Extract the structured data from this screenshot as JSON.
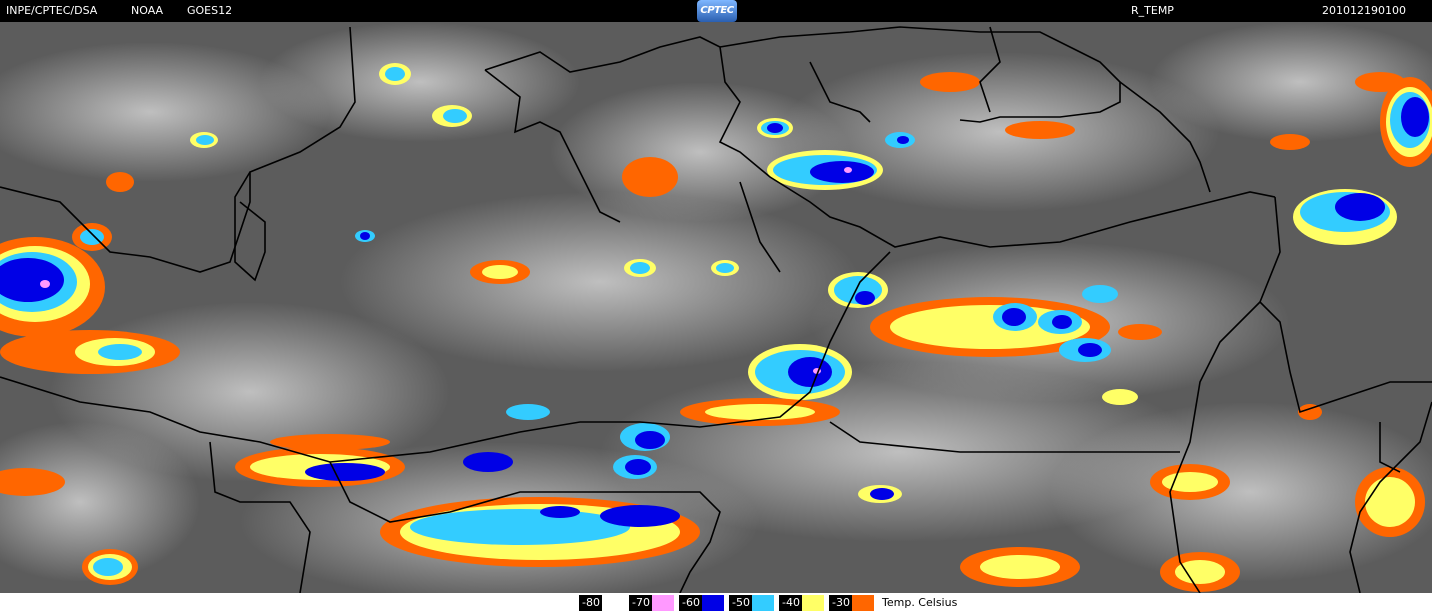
{
  "header": {
    "source": "INPE/CPTEC/DSA",
    "agency": "NOAA",
    "satellite": "GOES12",
    "logo_text": "CPTEC",
    "product": "R_TEMP",
    "timestamp": "201012190100"
  },
  "legend": {
    "entries": [
      {
        "label": "-80",
        "color": "#ffffff"
      },
      {
        "label": "-70",
        "color": "#ff99ff"
      },
      {
        "label": "-60",
        "color": "#0000e6"
      },
      {
        "label": "-50",
        "color": "#33ccff"
      },
      {
        "label": "-40",
        "color": "#ffff66"
      },
      {
        "label": "-30",
        "color": "#ff6600"
      }
    ],
    "unit": "Temp. Celsius"
  }
}
